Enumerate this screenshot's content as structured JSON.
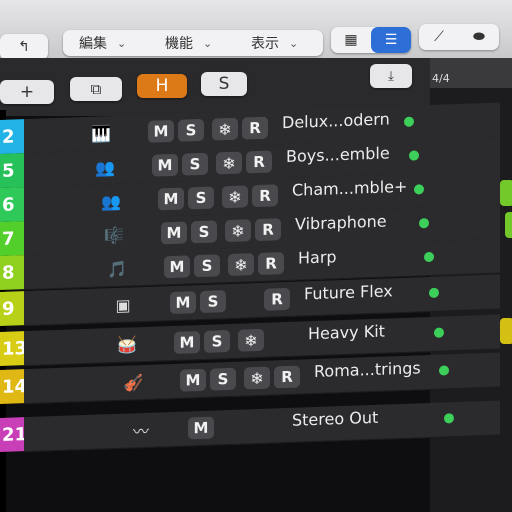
{
  "menubar": {
    "back_icon": "back-arrow-icon",
    "menus": [
      {
        "label": "編集"
      },
      {
        "label": "機能"
      },
      {
        "label": "表示"
      }
    ],
    "view_buttons": [
      "grid-view-icon",
      "list-view-icon"
    ],
    "tool_buttons": [
      "automation-curve-icon",
      "toggle-icon"
    ]
  },
  "header_toolbar": {
    "add_label": "+",
    "h_label": "H",
    "s_label": "S"
  },
  "ruler": {
    "time_sig": "4/4"
  },
  "tracks": [
    {
      "number": "2",
      "color": "#22b3e6",
      "name": "Delux...odern",
      "icon": "electric-piano-icon",
      "m": "M",
      "s": "S",
      "freeze": true,
      "r": "R",
      "dot": true
    },
    {
      "number": "5",
      "color": "#27c15a",
      "name": "Boys...emble",
      "icon": "choir-icon",
      "m": "M",
      "s": "S",
      "freeze": true,
      "r": "R",
      "dot": true
    },
    {
      "number": "6",
      "color": "#2fc95a",
      "name": "Cham...mble+",
      "icon": "choir-icon",
      "m": "M",
      "s": "S",
      "freeze": true,
      "r": "R",
      "dot": true
    },
    {
      "number": "7",
      "color": "#52cf2b",
      "name": "Vibraphone",
      "icon": "vibraphone-icon",
      "m": "M",
      "s": "S",
      "freeze": true,
      "r": "R",
      "dot": true
    },
    {
      "number": "8",
      "color": "#8fcf1e",
      "name": "Harp",
      "icon": "harp-icon",
      "m": "M",
      "s": "S",
      "freeze": true,
      "r": "R",
      "dot": true
    },
    {
      "number": "9",
      "color": "#b8d018",
      "name": "Future Flex",
      "icon": "drum-machine-icon",
      "m": "M",
      "s": "S",
      "freeze": false,
      "r": "R",
      "dot": true
    },
    {
      "number": "13",
      "color": "#d8cd14",
      "name": "Heavy Kit",
      "icon": "drum-kit-icon",
      "m": "M",
      "s": "S",
      "freeze": true,
      "r": "",
      "dot": true
    },
    {
      "number": "14",
      "color": "#e0b814",
      "name": "Roma...trings",
      "icon": "strings-icon",
      "m": "M",
      "s": "S",
      "freeze": true,
      "r": "R",
      "dot": true
    },
    {
      "number": "21",
      "color": "#c93fb8",
      "name": "Stereo Out",
      "icon": "waveform-icon",
      "m": "M",
      "s": "",
      "freeze": false,
      "r": "",
      "dot": true
    }
  ],
  "colors": {
    "accent_h": "#dd7a18",
    "active_view": "#2d6fd6",
    "status_dot": "#3cd05a"
  }
}
